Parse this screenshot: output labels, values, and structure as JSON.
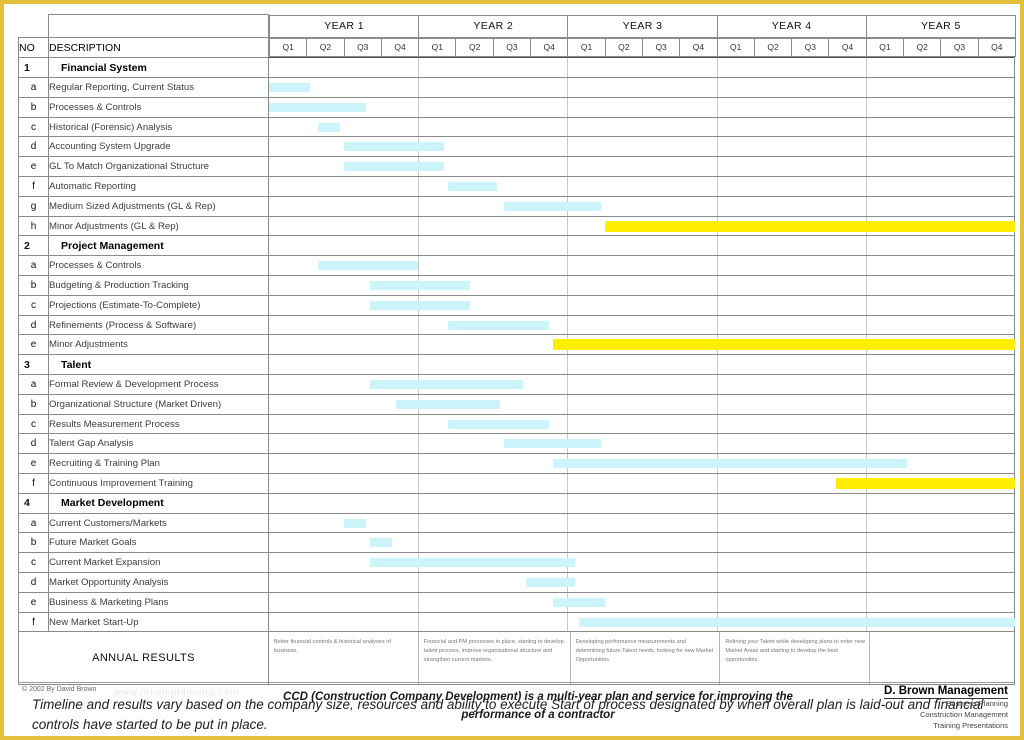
{
  "header": {
    "no_label": "NO",
    "description_label": "DESCRIPTION",
    "years": [
      "YEAR 1",
      "YEAR 2",
      "YEAR 3",
      "YEAR 4",
      "YEAR 5"
    ],
    "quarters": [
      "Q1",
      "Q2",
      "Q3",
      "Q4"
    ]
  },
  "colors": {
    "bar_cyan": "#ccf4fb",
    "bar_yellow": "#ffee00",
    "page_border": "#e3c13c",
    "grid": "#8a8a8a"
  },
  "sections": [
    {
      "no": "1",
      "title": "Financial System",
      "rows": [
        {
          "no": "a",
          "label": "Regular Reporting, Current Status",
          "start": 0.0,
          "end": 1.1,
          "color": "cyan"
        },
        {
          "no": "b",
          "label": "Processes & Controls",
          "start": 0.0,
          "end": 2.6,
          "color": "cyan"
        },
        {
          "no": "c",
          "label": "Historical (Forensic) Analysis",
          "start": 1.3,
          "end": 1.9,
          "color": "cyan"
        },
        {
          "no": "d",
          "label": "Accounting System Upgrade",
          "start": 2.0,
          "end": 4.7,
          "color": "cyan"
        },
        {
          "no": "e",
          "label": "GL To Match Organizational Structure",
          "start": 2.0,
          "end": 4.7,
          "color": "cyan"
        },
        {
          "no": "f",
          "label": "Automatic Reporting",
          "start": 4.8,
          "end": 6.1,
          "color": "cyan"
        },
        {
          "no": "g",
          "label": "Medium Sized Adjustments (GL & Rep)",
          "start": 6.3,
          "end": 8.9,
          "color": "cyan"
        },
        {
          "no": "h",
          "label": "Minor Adjustments (GL & Rep)",
          "start": 9.0,
          "end": 20.0,
          "color": "yellow"
        }
      ]
    },
    {
      "no": "2",
      "title": "Project Management",
      "rows": [
        {
          "no": "a",
          "label": "Processes & Controls",
          "start": 1.3,
          "end": 4.0,
          "color": "cyan"
        },
        {
          "no": "b",
          "label": "Budgeting & Production Tracking",
          "start": 2.7,
          "end": 5.4,
          "color": "cyan"
        },
        {
          "no": "c",
          "label": "Projections (Estimate-To-Complete)",
          "start": 2.7,
          "end": 5.4,
          "color": "cyan"
        },
        {
          "no": "d",
          "label": "Refinements (Process & Software)",
          "start": 4.8,
          "end": 7.5,
          "color": "cyan"
        },
        {
          "no": "e",
          "label": "Minor Adjustments",
          "start": 7.6,
          "end": 20.0,
          "color": "yellow"
        }
      ]
    },
    {
      "no": "3",
      "title": "Talent",
      "rows": [
        {
          "no": "a",
          "label": "Formal Review & Development Process",
          "start": 2.7,
          "end": 6.8,
          "color": "cyan"
        },
        {
          "no": "b",
          "label": "Organizational Structure (Market Driven)",
          "start": 3.4,
          "end": 6.2,
          "color": "cyan"
        },
        {
          "no": "c",
          "label": "Results Measurement Process",
          "start": 4.8,
          "end": 7.5,
          "color": "cyan"
        },
        {
          "no": "d",
          "label": "Talent Gap Analysis",
          "start": 6.3,
          "end": 8.9,
          "color": "cyan"
        },
        {
          "no": "e",
          "label": "Recruiting & Training Plan",
          "start": 7.6,
          "end": 17.1,
          "color": "cyan"
        },
        {
          "no": "f",
          "label": "Continuous Improvement Training",
          "start": 15.2,
          "end": 20.0,
          "color": "yellow"
        }
      ]
    },
    {
      "no": "4",
      "title": "Market Development",
      "rows": [
        {
          "no": "a",
          "label": "Current Customers/Markets",
          "start": 2.0,
          "end": 2.6,
          "color": "cyan"
        },
        {
          "no": "b",
          "label": "Future Market Goals",
          "start": 2.7,
          "end": 3.3,
          "color": "cyan"
        },
        {
          "no": "c",
          "label": "Current Market Expansion",
          "start": 2.7,
          "end": 8.2,
          "color": "cyan"
        },
        {
          "no": "d",
          "label": "Market Opportunity Analysis",
          "start": 6.9,
          "end": 8.2,
          "color": "cyan"
        },
        {
          "no": "e",
          "label": "Business & Marketing Plans",
          "start": 7.6,
          "end": 9.0,
          "color": "cyan"
        },
        {
          "no": "f",
          "label": "New Market Start-Up",
          "start": 8.3,
          "end": 20.0,
          "color": "cyan"
        }
      ]
    }
  ],
  "annual_results": {
    "label": "ANNUAL RESULTS",
    "cells": [
      "Better financial controls & historical analyses of business.",
      "Financial and PM processes in place, starting to develop talent process, improve organizational structure and strengthen current markets.",
      "Developing performance measurements and determining future Talent needs, looking for new Market Opportunities.",
      "Refining your Talent while developing plans to enter new Market Areas and starting to develop the best opportunities.",
      ""
    ]
  },
  "note": "Timeline and results vary based on the company size, resources and ability to execute   Start of process designated by when overall plan is laid-out and financial controls have started to be put in place.",
  "footer": {
    "copyright": "© 2002 By David Brown",
    "watermark": "www.lovelyplanning.com",
    "caption": "CCD (Construction Company Development) is a multi-year plan and service for improving the performance of a contractor",
    "brand_name": "D. Brown Management",
    "brand_lines": [
      "Business Planning",
      "Construction Management",
      "Training Presentations"
    ]
  }
}
